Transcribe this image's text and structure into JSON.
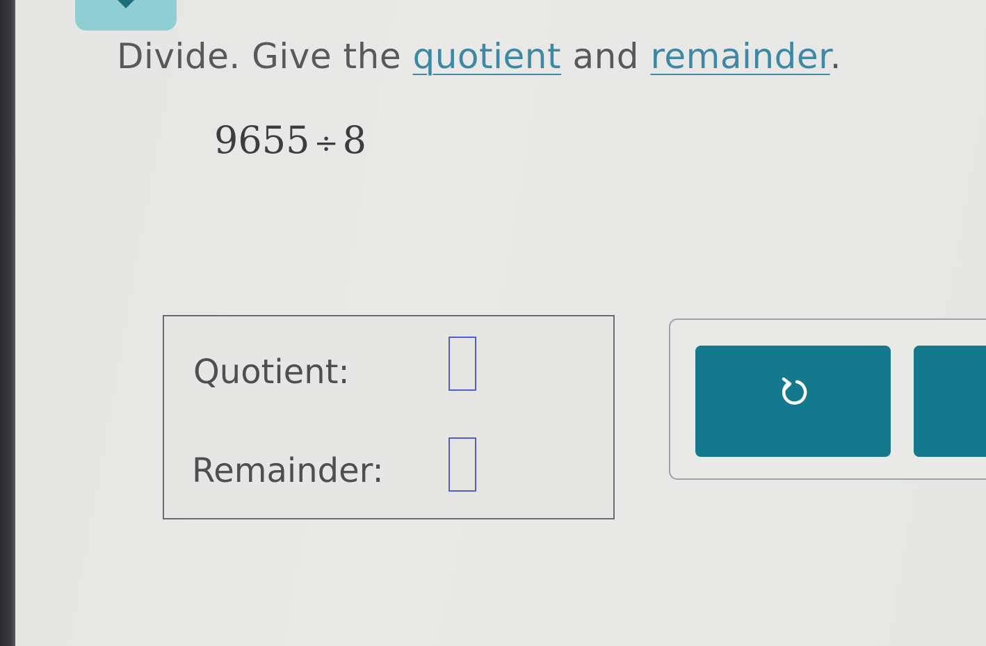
{
  "header": {
    "tab_icon": "chevron-down-icon"
  },
  "instructions": {
    "prefix": "Divide. Give the ",
    "quotient_link": "quotient",
    "middle": " and ",
    "remainder_link": "remainder",
    "suffix": "."
  },
  "problem": {
    "dividend": "9655",
    "operator": "÷",
    "divisor": "8"
  },
  "answer": {
    "quotient_label": "Quotient:",
    "quotient_value": "",
    "remainder_label": "Remainder:",
    "remainder_value": ""
  },
  "actions": {
    "undo_icon": "undo-icon",
    "next_icon": ""
  },
  "colors": {
    "accent": "#14798c",
    "link": "#3e88a6",
    "input_border": "#4f5fd2",
    "tab": "#8fcfd4"
  }
}
